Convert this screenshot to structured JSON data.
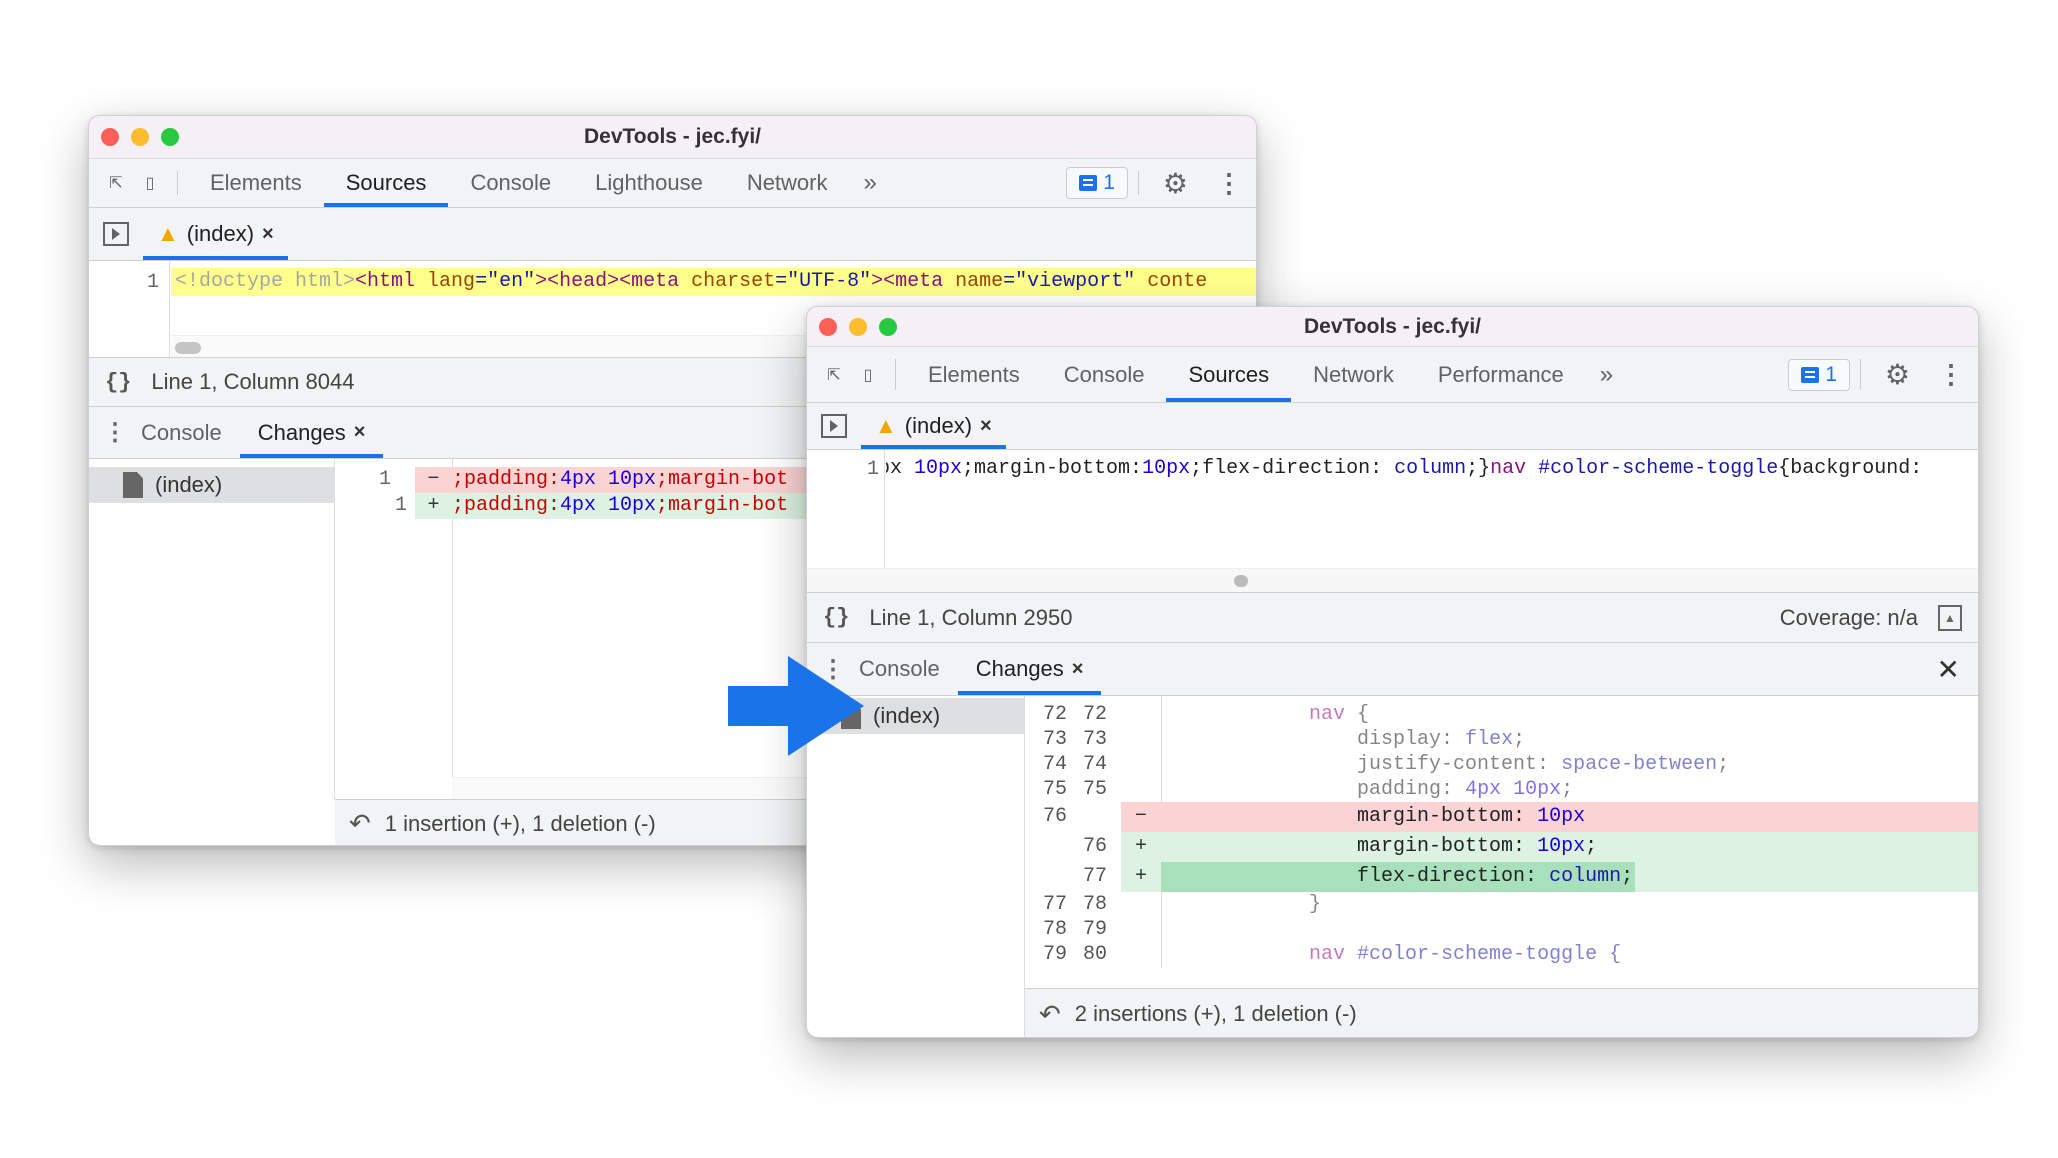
{
  "back": {
    "title": "DevTools - jec.fyi/",
    "tabs": [
      "Elements",
      "Sources",
      "Console",
      "Lighthouse",
      "Network"
    ],
    "active_tab": "Sources",
    "issues_count": "1",
    "file_tab": "(index)",
    "code_line_number": "1",
    "code_tokens": [
      {
        "t": "<!doctype html>",
        "c": "doc"
      },
      {
        "t": "<html ",
        "c": "tag"
      },
      {
        "t": "lang",
        "c": "attr"
      },
      {
        "t": "=\"en\"",
        "c": "val"
      },
      {
        "t": "><head><meta ",
        "c": "tag"
      },
      {
        "t": "charset",
        "c": "attr"
      },
      {
        "t": "=\"UTF-8\"",
        "c": "val"
      },
      {
        "t": "><meta ",
        "c": "tag"
      },
      {
        "t": "name",
        "c": "attr"
      },
      {
        "t": "=\"viewport\"",
        "c": "val"
      },
      {
        "t": " conte",
        "c": "attr"
      }
    ],
    "status": "Line 1, Column 8044",
    "drawer_tabs": [
      "Console",
      "Changes"
    ],
    "changes_file": "(index)",
    "diff": [
      {
        "old": "1",
        "new": "",
        "sign": "−",
        "tokens": [
          {
            "t": ";padding:",
            "c": "del"
          },
          {
            "t": "4px 10px",
            "c": "num"
          },
          {
            "t": ";margin-bot",
            "c": "del"
          }
        ]
      },
      {
        "old": "",
        "new": "1",
        "sign": "+",
        "tokens": [
          {
            "t": ";padding:",
            "c": "del"
          },
          {
            "t": "4px 10px",
            "c": "num"
          },
          {
            "t": ";margin-bot",
            "c": "del"
          }
        ]
      }
    ],
    "summary": "1 insertion (+), 1 deletion (-)"
  },
  "front": {
    "title": "DevTools - jec.fyi/",
    "tabs": [
      "Elements",
      "Console",
      "Sources",
      "Network",
      "Performance"
    ],
    "active_tab": "Sources",
    "issues_count": "1",
    "file_tab": "(index)",
    "code_line_number": "1",
    "code_tokens": [
      {
        "t": "px ",
        "c": "plain"
      },
      {
        "t": "10px",
        "c": "num"
      },
      {
        "t": ";margin-bottom:",
        "c": "plain"
      },
      {
        "t": "10px",
        "c": "num"
      },
      {
        "t": ";flex-direction: ",
        "c": "plain"
      },
      {
        "t": "column",
        "c": "val"
      },
      {
        "t": ";}",
        "c": "plain"
      },
      {
        "t": "nav",
        "c": "tag"
      },
      {
        "t": " #color-scheme-toggle",
        "c": "val"
      },
      {
        "t": "{background:",
        "c": "plain"
      }
    ],
    "status": "Line 1, Column 2950",
    "coverage": "Coverage: n/a",
    "drawer_tabs": [
      "Console",
      "Changes"
    ],
    "changes_file": "(index)",
    "diff": [
      {
        "old": "72",
        "new": "72",
        "sign": "",
        "type": "ctx",
        "tokens": [
          {
            "t": "            nav",
            "c": "tag"
          },
          {
            "t": " {",
            "c": "plain"
          }
        ]
      },
      {
        "old": "73",
        "new": "73",
        "sign": "",
        "type": "ctx",
        "tokens": [
          {
            "t": "                display: ",
            "c": "plain"
          },
          {
            "t": "flex",
            "c": "val"
          },
          {
            "t": ";",
            "c": "plain"
          }
        ]
      },
      {
        "old": "74",
        "new": "74",
        "sign": "",
        "type": "ctx",
        "tokens": [
          {
            "t": "                justify-content: ",
            "c": "plain"
          },
          {
            "t": "space-between",
            "c": "val"
          },
          {
            "t": ";",
            "c": "plain"
          }
        ]
      },
      {
        "old": "75",
        "new": "75",
        "sign": "",
        "type": "ctx",
        "tokens": [
          {
            "t": "                padding: ",
            "c": "plain"
          },
          {
            "t": "4px 10px",
            "c": "num"
          },
          {
            "t": ";",
            "c": "plain"
          }
        ]
      },
      {
        "old": "76",
        "new": "",
        "sign": "−",
        "type": "del",
        "tokens": [
          {
            "t": "                margin-bottom: ",
            "c": "prop"
          },
          {
            "t": "10px",
            "c": "num"
          }
        ]
      },
      {
        "old": "",
        "new": "76",
        "sign": "+",
        "type": "add",
        "tokens": [
          {
            "t": "                margin-bottom: ",
            "c": "prop"
          },
          {
            "t": "10px",
            "c": "num"
          },
          {
            "t": ";",
            "c": "prop"
          }
        ]
      },
      {
        "old": "",
        "new": "77",
        "sign": "+",
        "type": "add2",
        "tokens": [
          {
            "t": "                flex-direction: ",
            "c": "prop"
          },
          {
            "t": "column",
            "c": "val"
          },
          {
            "t": ";",
            "c": "prop"
          }
        ]
      },
      {
        "old": "77",
        "new": "78",
        "sign": "",
        "type": "ctx",
        "tokens": [
          {
            "t": "            }",
            "c": "plain"
          }
        ]
      },
      {
        "old": "78",
        "new": "79",
        "sign": "",
        "type": "ctx",
        "tokens": [
          {
            "t": "",
            "c": "plain"
          }
        ]
      },
      {
        "old": "79",
        "new": "80",
        "sign": "",
        "type": "ctx",
        "tokens": [
          {
            "t": "            nav",
            "c": "tag"
          },
          {
            "t": " #color-scheme-toggle {",
            "c": "val"
          }
        ]
      }
    ],
    "summary": "2 insertions (+), 1 deletion (-)"
  },
  "colors": {
    "accent": "#1a73e8",
    "arrow": "#1a73e8",
    "deleted_bg": "#fad4d4",
    "added_bg": "#ddf2e2",
    "added_strong_bg": "#a8e0bc",
    "highlight": "#ffff8c"
  },
  "icons": [
    "inspect-icon",
    "device-toolbar-icon",
    "more-tabs-icon",
    "issues-icon",
    "gear-icon",
    "kebab-menu-icon",
    "navigator-toggle-icon",
    "warning-icon",
    "close-icon",
    "pretty-print-icon",
    "coverage-icon",
    "file-icon",
    "undo-icon",
    "arrow-icon"
  ]
}
